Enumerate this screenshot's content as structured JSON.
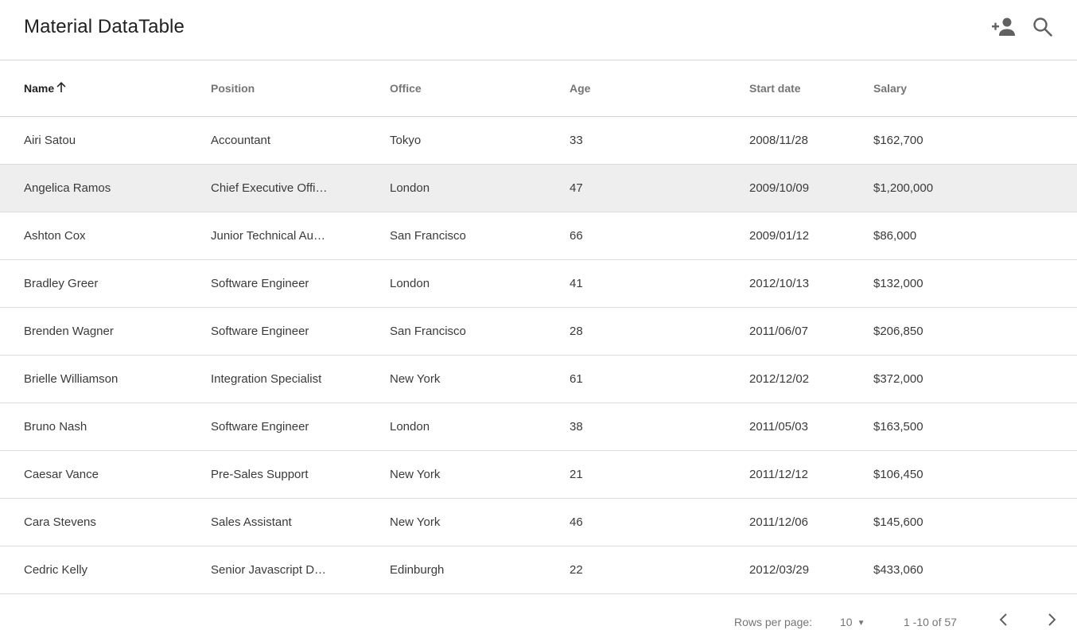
{
  "header": {
    "title": "Material DataTable",
    "actions": [
      {
        "icon": "person-add-icon",
        "label": "Add person"
      },
      {
        "icon": "search-icon",
        "label": "Search"
      }
    ]
  },
  "table": {
    "columns": [
      {
        "key": "name",
        "label": "Name",
        "sorted": "ascending"
      },
      {
        "key": "position",
        "label": "Position"
      },
      {
        "key": "office",
        "label": "Office"
      },
      {
        "key": "age",
        "label": "Age"
      },
      {
        "key": "start_date",
        "label": "Start date"
      },
      {
        "key": "salary",
        "label": "Salary"
      }
    ],
    "hovered_row": 1,
    "rows": [
      {
        "name": "Airi Satou",
        "position": "Accountant",
        "office": "Tokyo",
        "age": "33",
        "start_date": "2008/11/28",
        "salary": "$162,700"
      },
      {
        "name": "Angelica Ramos",
        "position": "Chief Executive Offi…",
        "office": "London",
        "age": "47",
        "start_date": "2009/10/09",
        "salary": "$1,200,000"
      },
      {
        "name": "Ashton Cox",
        "position": "Junior Technical Au…",
        "office": "San Francisco",
        "age": "66",
        "start_date": "2009/01/12",
        "salary": "$86,000"
      },
      {
        "name": "Bradley Greer",
        "position": "Software Engineer",
        "office": "London",
        "age": "41",
        "start_date": "2012/10/13",
        "salary": "$132,000"
      },
      {
        "name": "Brenden Wagner",
        "position": "Software Engineer",
        "office": "San Francisco",
        "age": "28",
        "start_date": "2011/06/07",
        "salary": "$206,850"
      },
      {
        "name": "Brielle Williamson",
        "position": "Integration Specialist",
        "office": "New York",
        "age": "61",
        "start_date": "2012/12/02",
        "salary": "$372,000"
      },
      {
        "name": "Bruno Nash",
        "position": "Software Engineer",
        "office": "London",
        "age": "38",
        "start_date": "2011/05/03",
        "salary": "$163,500"
      },
      {
        "name": "Caesar Vance",
        "position": "Pre-Sales Support",
        "office": "New York",
        "age": "21",
        "start_date": "2011/12/12",
        "salary": "$106,450"
      },
      {
        "name": "Cara Stevens",
        "position": "Sales Assistant",
        "office": "New York",
        "age": "46",
        "start_date": "2011/12/06",
        "salary": "$145,600"
      },
      {
        "name": "Cedric Kelly",
        "position": "Senior Javascript D…",
        "office": "Edinburgh",
        "age": "22",
        "start_date": "2012/03/29",
        "salary": "$433,060"
      }
    ]
  },
  "pagination": {
    "rows_per_page_label": "Rows per page:",
    "rows_per_page_value": "10",
    "dropdown_arrow": "▼",
    "range_text": "1 -10 of 57",
    "prev_label": "Previous page",
    "next_label": "Next page"
  }
}
